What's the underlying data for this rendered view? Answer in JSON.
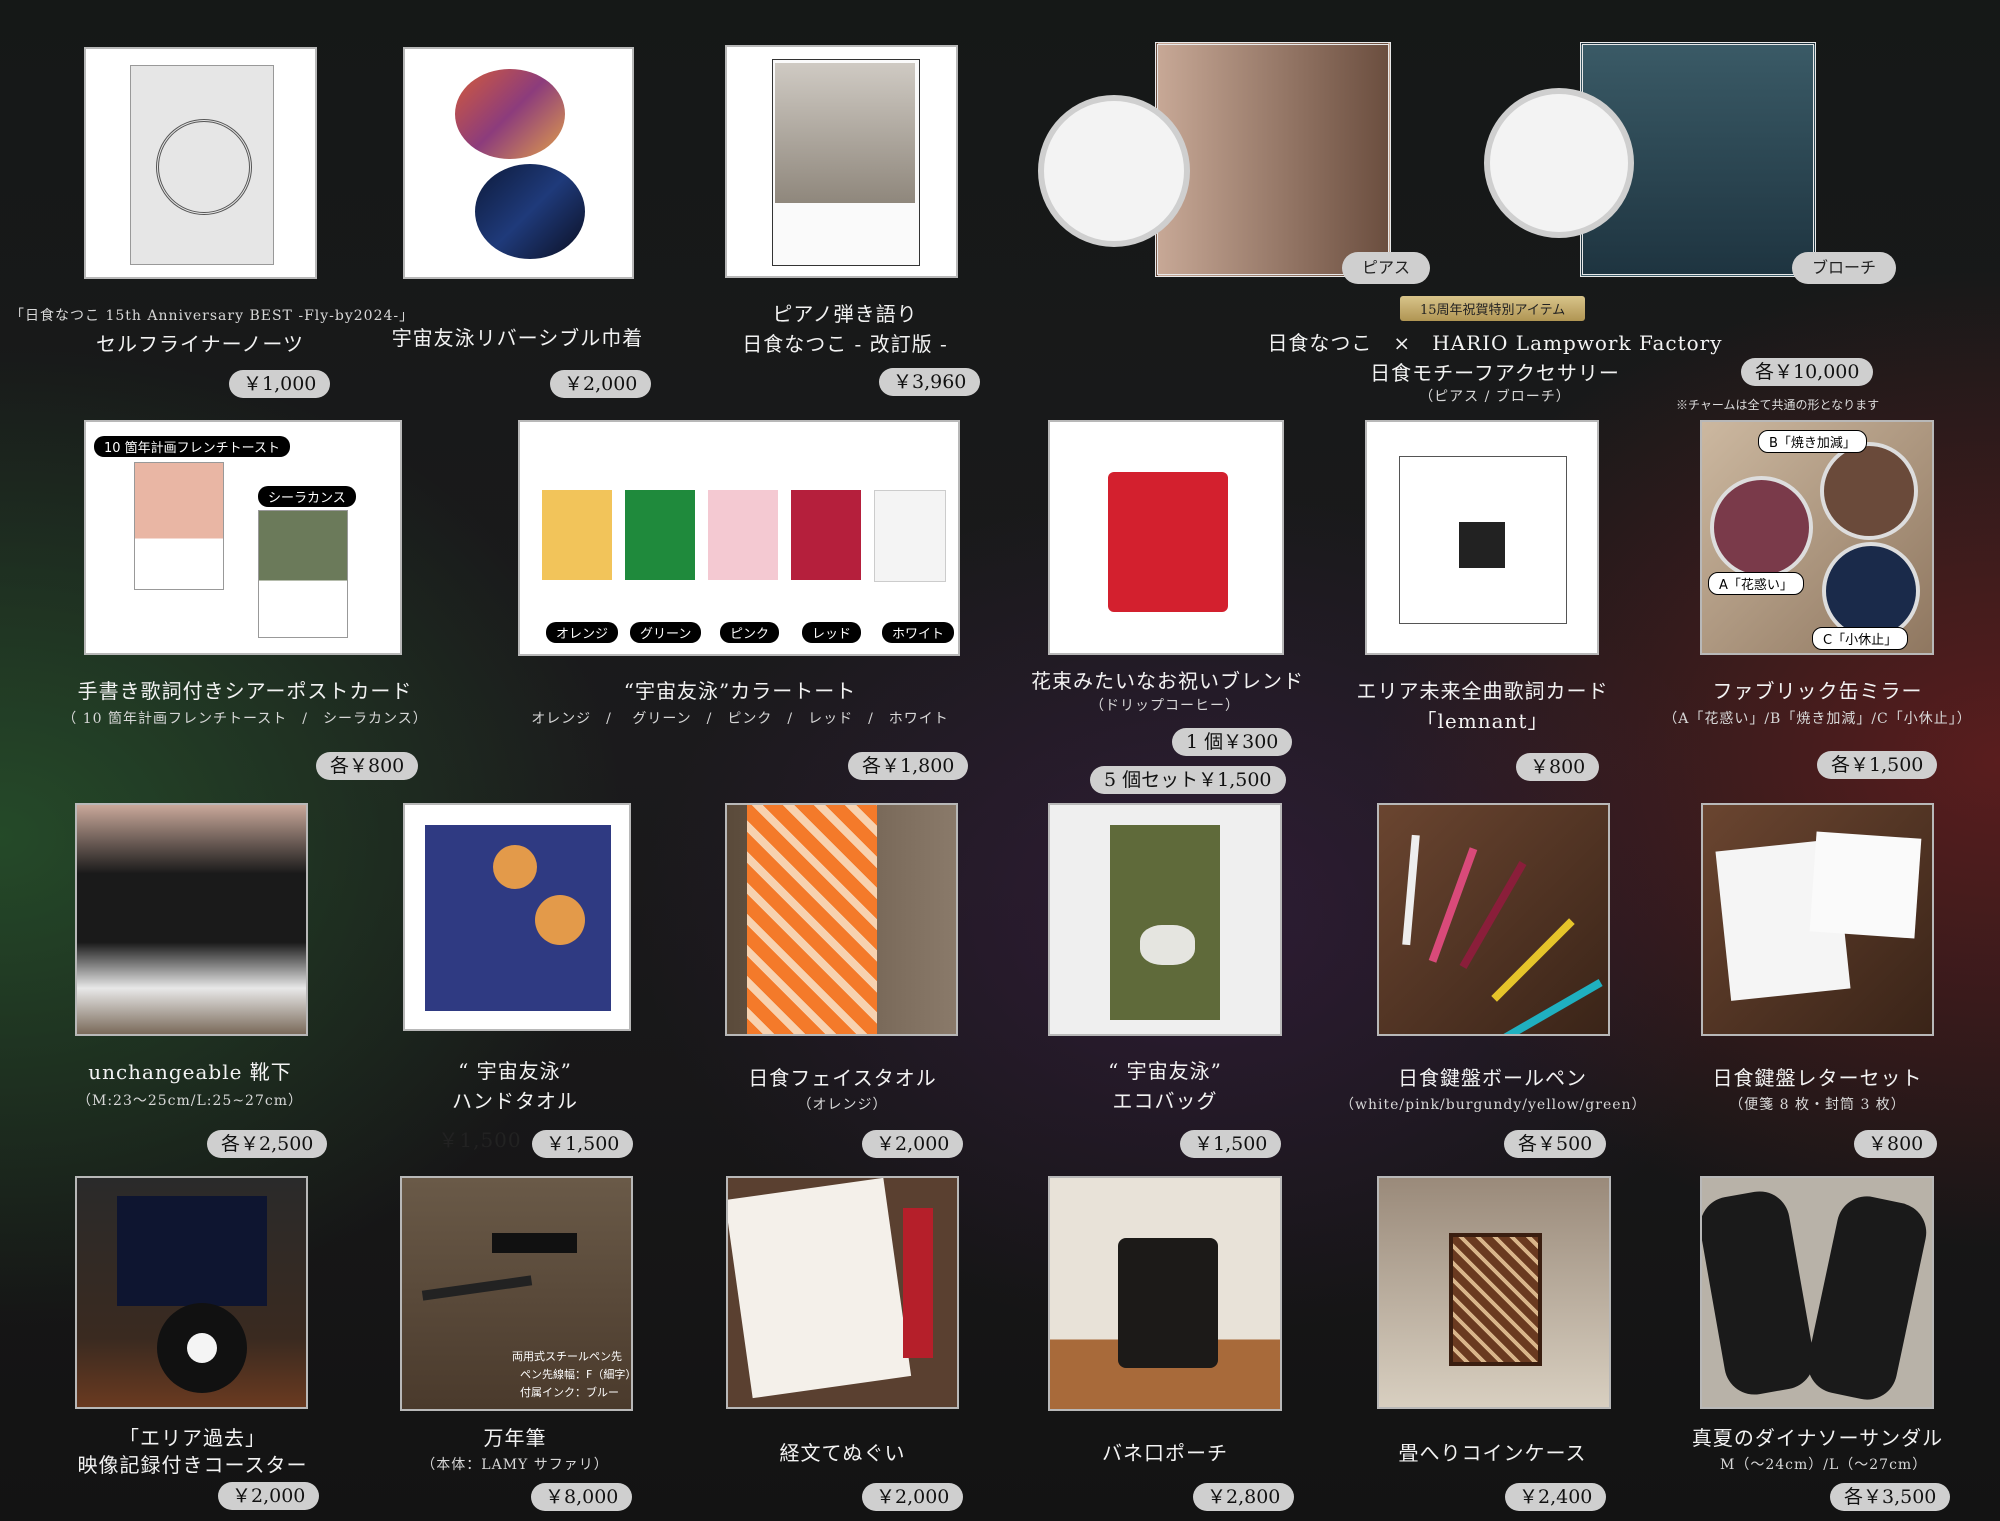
{
  "items": {
    "selfliner": {
      "line1": "「日食なつこ 15th Anniversary BEST -Fly-by2024-」",
      "line2": "セルフライナーノーツ",
      "price": "￥1,000"
    },
    "kinchaku": {
      "line1": "宇宙友泳リバーシブル巾着",
      "price": "￥2,000"
    },
    "piano": {
      "line1": "ピアノ弾き語り",
      "line2": "日食なつこ - 改訂版 -",
      "price": "￥3,960"
    },
    "accessory": {
      "line1": "日食なつこ　×　HARIO Lampwork Factory",
      "line2": "日食モチーフアクセサリー",
      "line3": "（ピアス / ブローチ）",
      "price": "各￥10,000",
      "note": "※チャームは全て共通の形となります",
      "ribbon": "15周年祝賀特別アイテム",
      "pierce": "ピアス",
      "brooch": "ブローチ"
    },
    "postcard": {
      "line1": "手書き歌詞付きシアーポストカード",
      "line2": "（ 10 箇年計画フレンチトースト　/　シーラカンス）",
      "price": "各￥800",
      "tag1": "10 箇年計画フレンチトースト",
      "tag2": "シーラカンス"
    },
    "tote": {
      "line1": "“宇宙友泳”カラートート",
      "line2": "オレンジ　/　 グリーン　/　ピンク　/　レッド　/　ホワイト",
      "price": "各￥1,800",
      "colors": [
        "オレンジ",
        "グリーン",
        "ピンク",
        "レッド",
        "ホワイト"
      ]
    },
    "blend": {
      "line1": "花束みたいなお祝いブレンド",
      "line2": "（ドリップコーヒー）",
      "price1": "1 個￥300",
      "price2": "5 個セット￥1,500"
    },
    "lyriccard": {
      "line1": "エリア未来全曲歌詞カード",
      "line2": "「lemnant」",
      "price": "￥800"
    },
    "mirror": {
      "line1": "ファブリック缶ミラー",
      "line2": "（A「花惑い」/B「焼き加減」/C「小休止」）",
      "price": "各￥1,500",
      "tagA": "A「花惑い」",
      "tagB": "B「焼き加減」",
      "tagC": "C「小休止」"
    },
    "socks": {
      "line1": "unchangeable 靴下",
      "line2": "（M:23～25cm/L:25~27cm）",
      "price": "各￥2,500"
    },
    "handtowel": {
      "line1": "“ 宇宙友泳”",
      "line2": "ハンドタオル",
      "price": "￥1,500",
      "ghost": "￥1,500"
    },
    "facetowel": {
      "line1": "日食フェイスタオル",
      "line2": "（オレンジ）",
      "price": "￥2,000"
    },
    "ecobag": {
      "line1": "“ 宇宙友泳”",
      "line2": "エコバッグ",
      "price": "￥1,500"
    },
    "pen": {
      "line1": "日食鍵盤ボールペン",
      "line2": "（white/pink/burgundy/yellow/green）",
      "price": "各￥500"
    },
    "letter": {
      "line1": "日食鍵盤レターセット",
      "line2": "（便箋 8 枚・封筒 3 枚）",
      "price": "￥800"
    },
    "coaster": {
      "line1": "「エリア過去」",
      "line2": "映像記録付きコースター",
      "price": "￥2,000"
    },
    "fountain": {
      "line1": "万年筆",
      "line2": "（本体：LAMY サファリ）",
      "price": "￥8,000",
      "spec1": "両用式スチールペン先",
      "spec2": "ペン先線幅：F（細字）",
      "spec3": "付属インク：ブルー"
    },
    "tenugui": {
      "line1": "経文てぬぐい",
      "price": "￥2,000"
    },
    "pouch": {
      "line1": "バネ口ポーチ",
      "price": "￥2,800"
    },
    "coincase": {
      "line1": "畳へりコインケース",
      "price": "￥2,400"
    },
    "sandal": {
      "line1": "真夏のダイナソーサンダル",
      "line2": "M（～24cm）/L（～27cm）",
      "price": "各￥3,500"
    }
  },
  "colors": {
    "orange": "#f2c45a",
    "green": "#1f8a3c",
    "pink": "#f4c9d2",
    "red": "#b51f3c",
    "white": "#f4f4f4"
  }
}
